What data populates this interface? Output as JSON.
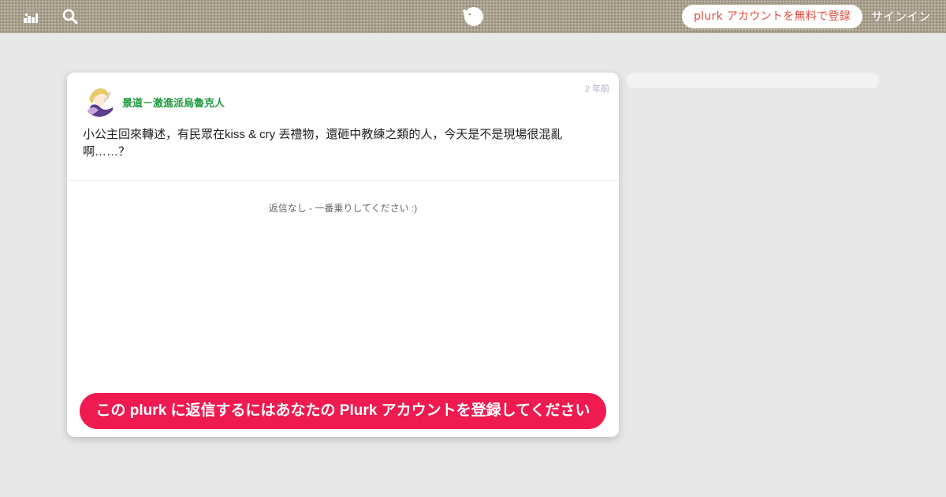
{
  "header": {
    "stats_icon": "stats-icon",
    "search_icon": "search-icon",
    "logo_icon": "plurk-logo-icon",
    "signup_label": "plurk アカウントを無料で登録",
    "signin_label": "サインイン",
    "signup_color": "#e64a3c"
  },
  "post": {
    "avatar_icon": "avatar",
    "username": "景道－激進派烏魯克人",
    "username_color": "#1e9a3c",
    "timestamp": "2 年前",
    "content_line1": "小公主回來轉述，有民眾在kiss & cry 丟禮物，還砸中教練之類的人，今天是不是現場很混亂",
    "content_line2": "啊……？"
  },
  "responses": {
    "empty_text": "返信なし - 一番乗りしてください :)"
  },
  "cta": {
    "label": "この plurk に返信するにはあなたの Plurk アカウントを登録してください",
    "color": "#ee1a50"
  },
  "colors": {
    "page_background": "#e7e7e7",
    "topbar": "#a99f8c",
    "card": "#ffffff"
  }
}
